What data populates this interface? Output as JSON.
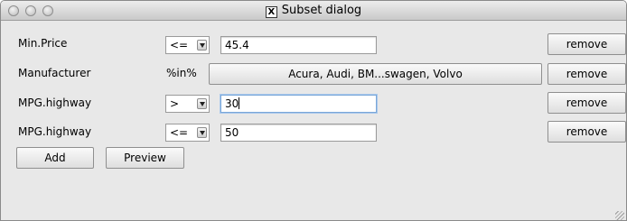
{
  "window": {
    "title": "Subset dialog",
    "title_icon_glyph": "X"
  },
  "rows": [
    {
      "label": "Min.Price",
      "operator": "<=",
      "value": "45.4",
      "remove_label": "remove"
    },
    {
      "label": "Manufacturer",
      "operator": "%in%",
      "value": "Acura, Audi, BM...swagen, Volvo",
      "remove_label": "remove"
    },
    {
      "label": "MPG.highway",
      "operator": ">",
      "value": "30",
      "remove_label": "remove"
    },
    {
      "label": "MPG.highway",
      "operator": "<=",
      "value": "50",
      "remove_label": "remove"
    }
  ],
  "buttons": {
    "add": "Add",
    "preview": "Preview"
  }
}
